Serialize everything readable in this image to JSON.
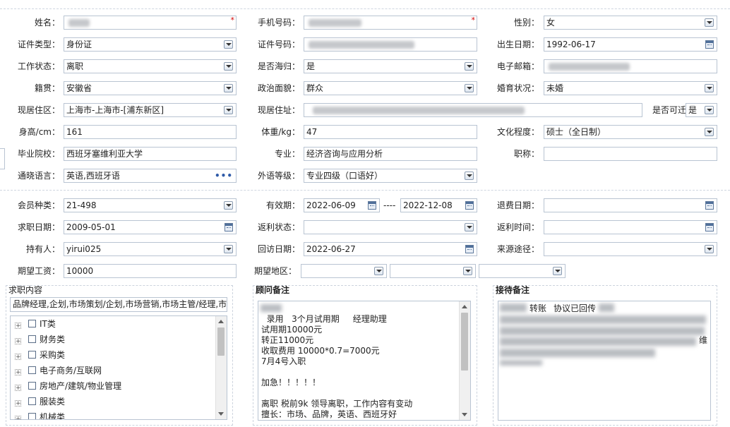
{
  "labels": {
    "name": "姓名：",
    "phone": "手机号码：",
    "gender": "性别：",
    "id_type": "证件类型：",
    "id_no": "证件号码：",
    "birth": "出生日期：",
    "work_status": "工作状态：",
    "overseas": "是否海归：",
    "email": "电子邮箱：",
    "native": "籍贯：",
    "political": "政治面貌：",
    "marital": "婚育状况：",
    "residence_area": "现居住区：",
    "residence_addr": "现居住址：",
    "relocate": "是否可迁",
    "height": "身高/cm：",
    "weight": "体重/kg：",
    "education": "文化程度：",
    "school": "毕业院校：",
    "major": "专业：",
    "title": "职称：",
    "languages": "通晓语言：",
    "fl_level": "外语等级：",
    "member_type": "会员种类：",
    "valid": "有效期：",
    "refund_date": "退费日期：",
    "job_date": "求职日期：",
    "rebate_status": "返利状态：",
    "rebate_time": "返利时间：",
    "holder": "持有人：",
    "visit_date": "回访日期：",
    "source": "来源途径：",
    "salary": "期望工资：",
    "area": "期望地区："
  },
  "values": {
    "gender": "女",
    "id_type": "身份证",
    "birth": "1992-06-17",
    "work_status": "离职",
    "overseas": "是",
    "native": "安徽省",
    "political": "群众",
    "marital": "未婚",
    "residence_area": "上海市-上海市-[浦东新区]",
    "relocate": "是",
    "height": "161",
    "weight": "47",
    "education": "硕士（全日制）",
    "school": "西班牙塞维利亚大学",
    "major": "经济咨询与应用分析",
    "title": "",
    "languages": "英语,西班牙语",
    "fl_level": "专业四级（口语好）",
    "member_type": "21-498",
    "valid_from": "2022-06-09",
    "valid_sep": "----",
    "valid_to": "2022-12-08",
    "refund_date": "",
    "job_date": "2009-05-01",
    "rebate_status": "",
    "rebate_time": "",
    "holder": "yirui025",
    "visit_date": "2022-06-27",
    "source": "",
    "salary": "10000",
    "area1": "",
    "area2": "",
    "area3": ""
  },
  "required_mark": "*",
  "ellipsis": "•••",
  "job_intent": {
    "title": "求职内容",
    "summary": "品牌经理,企划,市场策划/企划,市场营销,市场主管/经理,市场",
    "categories": [
      "IT类",
      "财务类",
      "采购类",
      "电子商务/互联网",
      "房地产/建筑/物业管理",
      "服装类",
      "机械类"
    ]
  },
  "consultant_notes": {
    "title": "顾问备注",
    "text": "录用   3个月试用期     经理助理\n试用期10000元\n转正11000元\n收取费用 10000*0.7=7000元\n7月4号入职\n\n加急！！！！！\n\n离职 税前9k 领导离职，工作内容有变动\n擅长：市场、品牌，英语、西班牙好\n诉求：商务、市场、品牌方向，行业不限制，平台大"
  },
  "reception_notes": {
    "title": "接待备注",
    "line1_a": "转账",
    "line1_b": "协议已回传",
    "tail_char": "维"
  },
  "colors": {
    "border": "#b9c4d2",
    "required": "#d10000",
    "link": "#2e5aa8"
  }
}
